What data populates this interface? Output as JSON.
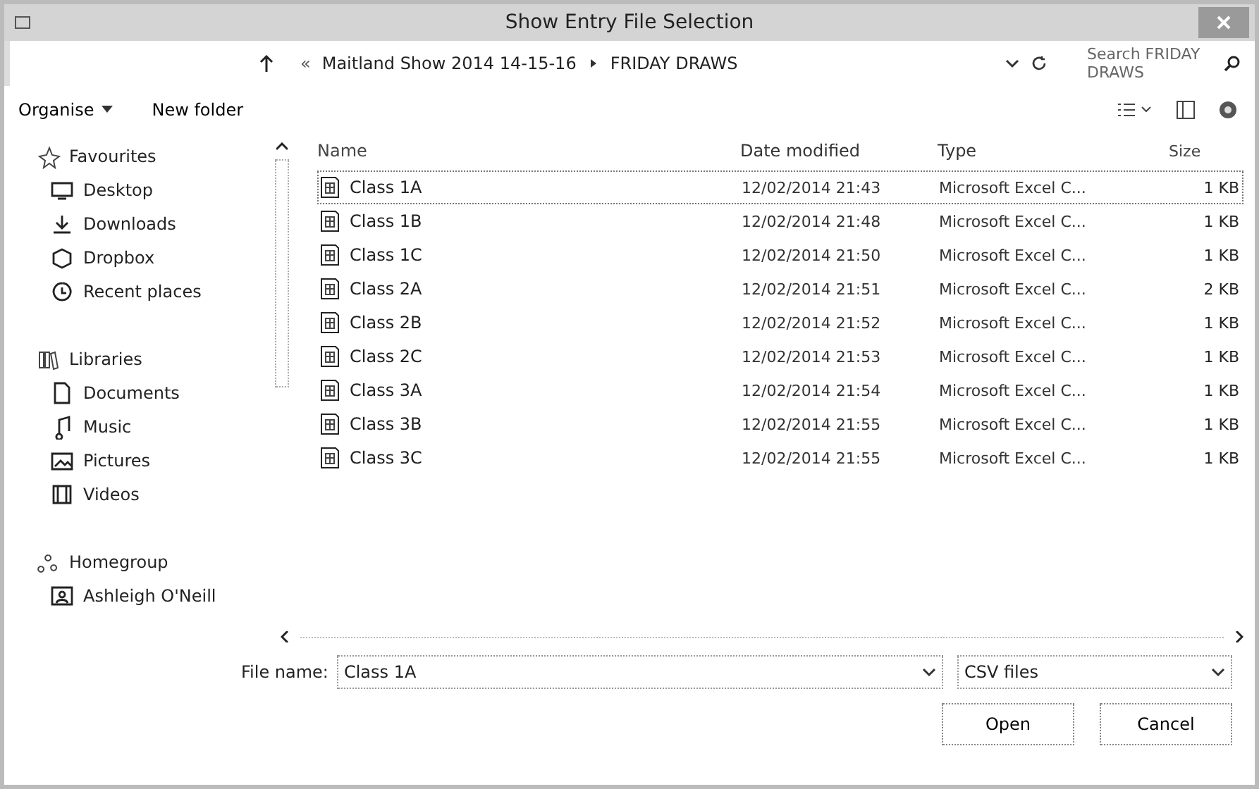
{
  "window": {
    "title": "Show Entry File Selection"
  },
  "address_bar": {
    "path": [
      {
        "label": "Maitland Show 2014 14-15-16"
      },
      {
        "label": "FRIDAY DRAWS"
      }
    ],
    "overflow": "«",
    "search_placeholder": "Search FRIDAY DRAWS"
  },
  "toolbar": {
    "items": [
      {
        "label": "Organise",
        "kind": "menu"
      },
      {
        "label": "New folder",
        "kind": "button"
      }
    ]
  },
  "navigation": [
    {
      "label": "Favourites",
      "children": [
        {
          "label": "Desktop"
        },
        {
          "label": "Downloads"
        },
        {
          "label": "Dropbox"
        },
        {
          "label": "Recent places"
        }
      ]
    },
    {
      "label": "Libraries",
      "children": [
        {
          "label": "Documents"
        },
        {
          "label": "Music"
        },
        {
          "label": "Pictures"
        },
        {
          "label": "Videos"
        }
      ]
    },
    {
      "label": "Homegroup",
      "children": [
        {
          "label": "Ashleigh O'Neill"
        }
      ]
    }
  ],
  "file_list": {
    "columns": [
      "Name",
      "Date modified",
      "Type",
      "Size"
    ],
    "rows": [
      {
        "name": "Class 1A",
        "date": "12/02/2014 21:43",
        "type": "Microsoft Excel C...",
        "size": "1 KB",
        "selected": true
      },
      {
        "name": "Class 1B",
        "date": "12/02/2014 21:48",
        "type": "Microsoft Excel C...",
        "size": "1 KB",
        "selected": false
      },
      {
        "name": "Class 1C",
        "date": "12/02/2014 21:50",
        "type": "Microsoft Excel C...",
        "size": "1 KB",
        "selected": false
      },
      {
        "name": "Class 2A",
        "date": "12/02/2014 21:51",
        "type": "Microsoft Excel C...",
        "size": "2 KB",
        "selected": false
      },
      {
        "name": "Class 2B",
        "date": "12/02/2014 21:52",
        "type": "Microsoft Excel C...",
        "size": "1 KB",
        "selected": false
      },
      {
        "name": "Class 2C",
        "date": "12/02/2014 21:53",
        "type": "Microsoft Excel C...",
        "size": "1 KB",
        "selected": false
      },
      {
        "name": "Class 3A",
        "date": "12/02/2014 21:54",
        "type": "Microsoft Excel C...",
        "size": "1 KB",
        "selected": false
      },
      {
        "name": "Class 3B",
        "date": "12/02/2014 21:55",
        "type": "Microsoft Excel C...",
        "size": "1 KB",
        "selected": false
      },
      {
        "name": "Class 3C",
        "date": "12/02/2014 21:55",
        "type": "Microsoft Excel C...",
        "size": "1 KB",
        "selected": false
      }
    ]
  },
  "file_name": {
    "label": "File name:",
    "value": "Class 1A"
  },
  "file_type": {
    "value": "CSV files"
  },
  "buttons": [
    "Open",
    "Cancel"
  ]
}
